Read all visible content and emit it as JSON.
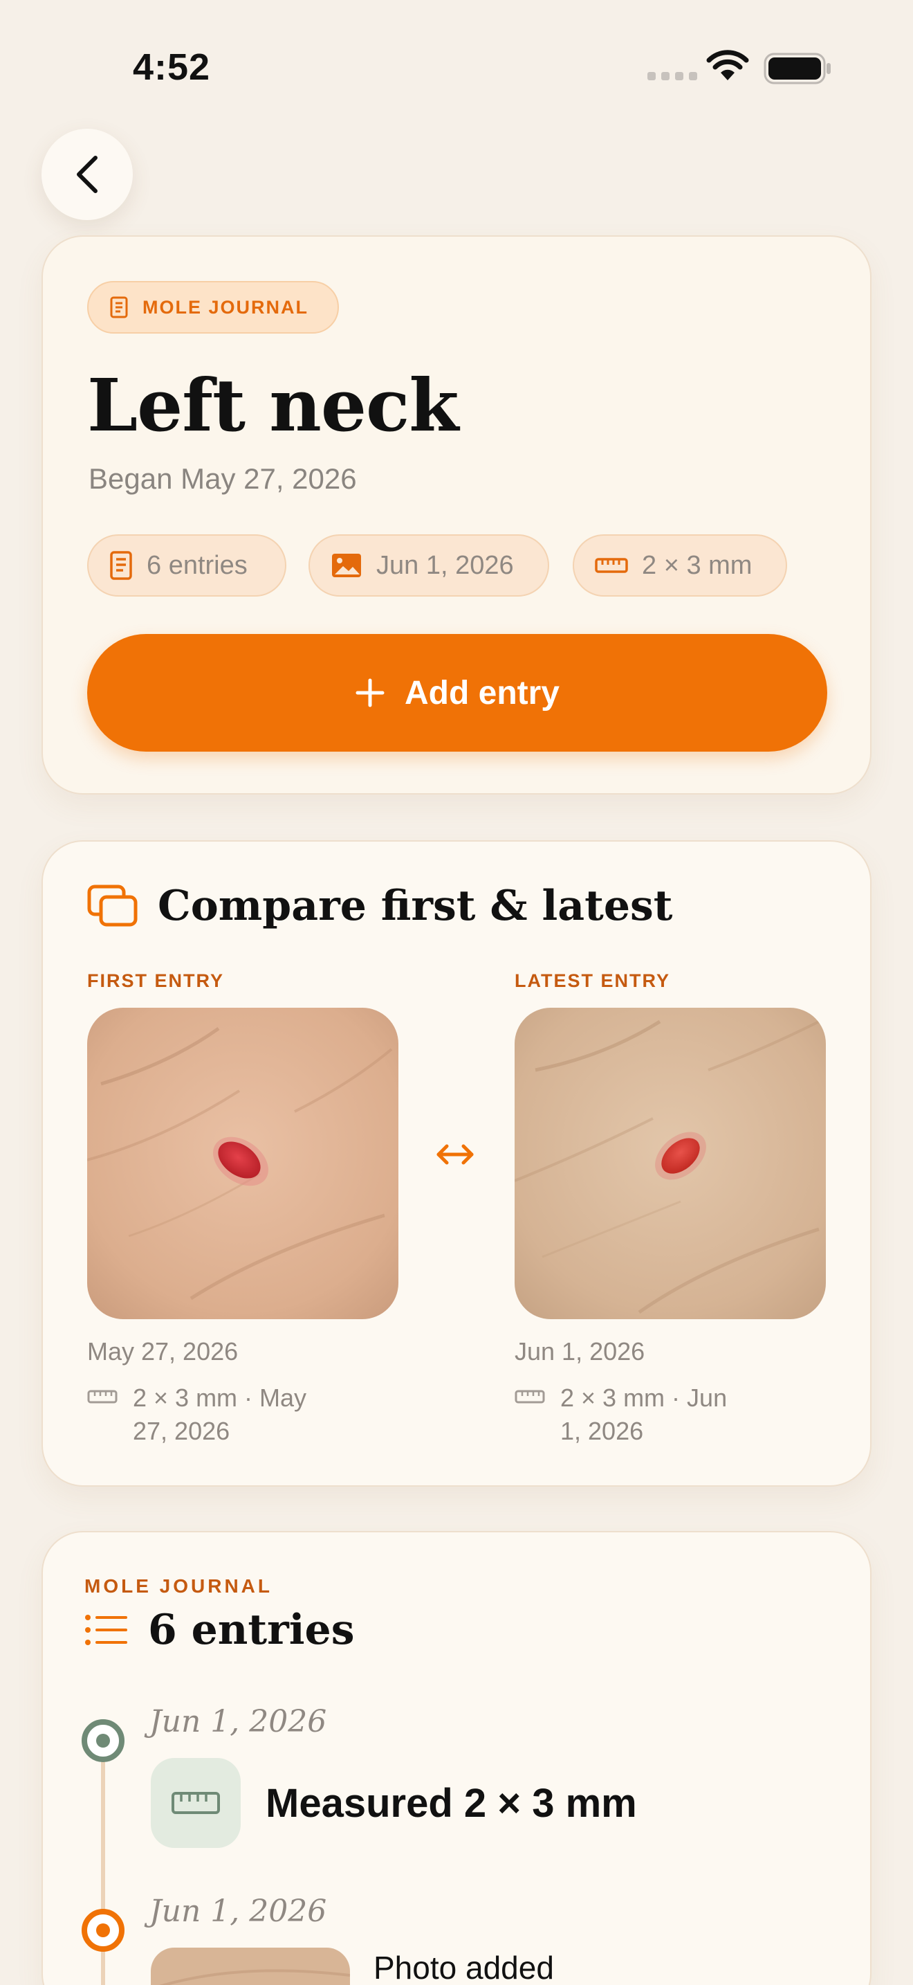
{
  "status_bar": {
    "time": "4:52"
  },
  "header": {
    "back_icon": "chevron-left-icon"
  },
  "summary": {
    "badge_label": "MOLE JOURNAL",
    "title": "Left neck",
    "subtitle": "Began May 27, 2026",
    "chips": [
      {
        "icon": "document-icon",
        "label": "6 entries"
      },
      {
        "icon": "image-icon",
        "label": "Jun 1, 2026"
      },
      {
        "icon": "ruler-icon",
        "label": "2 × 3 mm"
      }
    ],
    "add_button_label": "Add entry"
  },
  "compare": {
    "title": "Compare first & latest",
    "first": {
      "label": "FIRST ENTRY",
      "date": "May 27, 2026",
      "measurement_line1": "2 × 3 mm · May",
      "measurement_line2": "27, 2026"
    },
    "latest": {
      "label": "LATEST ENTRY",
      "date": "Jun 1, 2026",
      "measurement_line1": "2 × 3 mm · Jun",
      "measurement_line2": "1, 2026"
    }
  },
  "journal": {
    "label": "MOLE JOURNAL",
    "title": "6 entries",
    "entries": [
      {
        "date": "Jun 1, 2026",
        "text": "Measured 2 × 3 mm",
        "icon": "ruler-icon"
      },
      {
        "date": "Jun 1, 2026",
        "text": "Photo added",
        "icon": "photo-thumbnail"
      }
    ]
  },
  "colors": {
    "accent": "#f07206",
    "background": "#f6f0e8",
    "card": "#fdf9f2",
    "sage": "#6f8a76"
  }
}
